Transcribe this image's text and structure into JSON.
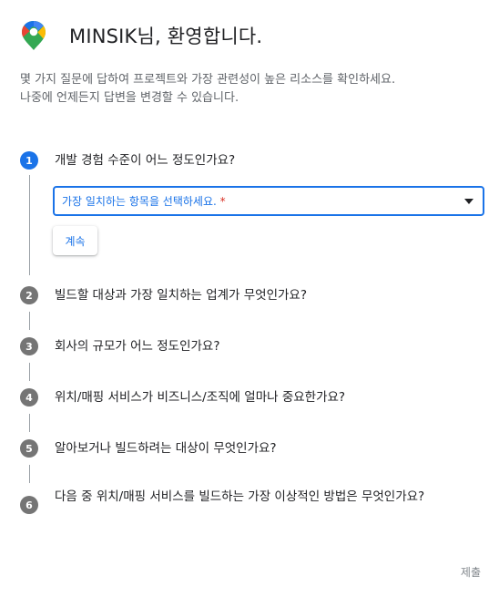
{
  "header": {
    "title": "MINSIK님, 환영합니다.",
    "logo": "google-maps-pin-icon"
  },
  "intro": {
    "line1": "몇 가지 질문에 답하여 프로젝트와 가장 관련성이 높은 리소스를 확인하세요.",
    "line2": "나중에 언제든지 답변을 변경할 수 있습니다."
  },
  "questions": [
    {
      "num": "1",
      "text": "개발 경험 수준이 어느 정도인가요?"
    },
    {
      "num": "2",
      "text": "빌드할 대상과 가장 일치하는 업계가 무엇인가요?"
    },
    {
      "num": "3",
      "text": "회사의 규모가 어느 정도인가요?"
    },
    {
      "num": "4",
      "text": "위치/매핑 서비스가 비즈니스/조직에 얼마나 중요한가요?"
    },
    {
      "num": "5",
      "text": "알아보거나 빌드하려는 대상이 무엇인가요?"
    },
    {
      "num": "6",
      "text": "다음 중 위치/매핑 서비스를 빌드하는 가장 이상적인 방법은 무엇인가요?"
    }
  ],
  "form": {
    "select_placeholder": "가장 일치하는 항목을 선택하세요.",
    "required_mark": "*",
    "continue_label": "계속",
    "submit_label": "제출"
  },
  "colors": {
    "accent": "#1a73e8",
    "step_inactive": "#757575",
    "required": "#d93025"
  }
}
